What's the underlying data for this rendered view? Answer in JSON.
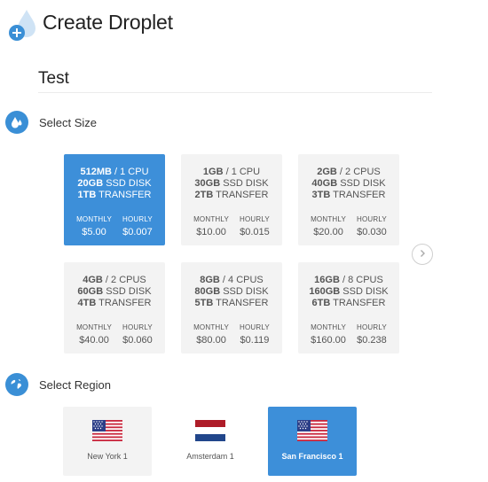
{
  "header": {
    "title": "Create Droplet",
    "logo_icon": "droplet-plus-icon"
  },
  "hostname": {
    "value": "Test"
  },
  "size_section": {
    "title": "Select Size",
    "icon": "droplets-icon",
    "options": [
      {
        "mem": "512MB",
        "cpu": "1 CPU",
        "disk": "20GB",
        "disk_unit": "SSD DISK",
        "transfer": "1TB",
        "transfer_unit": "TRANSFER",
        "monthly_label": "MONTHLY",
        "hourly_label": "HOURLY",
        "monthly": "$5.00",
        "hourly": "$0.007",
        "selected": true
      },
      {
        "mem": "1GB",
        "cpu": "1 CPU",
        "disk": "30GB",
        "disk_unit": "SSD DISK",
        "transfer": "2TB",
        "transfer_unit": "TRANSFER",
        "monthly_label": "MONTHLY",
        "hourly_label": "HOURLY",
        "monthly": "$10.00",
        "hourly": "$0.015",
        "selected": false
      },
      {
        "mem": "2GB",
        "cpu": "2 CPUS",
        "disk": "40GB",
        "disk_unit": "SSD DISK",
        "transfer": "3TB",
        "transfer_unit": "TRANSFER",
        "monthly_label": "MONTHLY",
        "hourly_label": "HOURLY",
        "monthly": "$20.00",
        "hourly": "$0.030",
        "selected": false
      },
      {
        "mem": "4GB",
        "cpu": "2 CPUS",
        "disk": "60GB",
        "disk_unit": "SSD DISK",
        "transfer": "4TB",
        "transfer_unit": "TRANSFER",
        "monthly_label": "MONTHLY",
        "hourly_label": "HOURLY",
        "monthly": "$40.00",
        "hourly": "$0.060",
        "selected": false
      },
      {
        "mem": "8GB",
        "cpu": "4 CPUS",
        "disk": "80GB",
        "disk_unit": "SSD DISK",
        "transfer": "5TB",
        "transfer_unit": "TRANSFER",
        "monthly_label": "MONTHLY",
        "hourly_label": "HOURLY",
        "monthly": "$80.00",
        "hourly": "$0.119",
        "selected": false
      },
      {
        "mem": "16GB",
        "cpu": "8 CPUS",
        "disk": "160GB",
        "disk_unit": "SSD DISK",
        "transfer": "6TB",
        "transfer_unit": "TRANSFER",
        "monthly_label": "MONTHLY",
        "hourly_label": "HOURLY",
        "monthly": "$160.00",
        "hourly": "$0.238",
        "selected": false
      }
    ],
    "next_icon": "chevron-right-icon"
  },
  "region_section": {
    "title": "Select Region",
    "icon": "globe-icon",
    "regions": [
      {
        "name": "New York 1",
        "flag": "us-flag-icon",
        "selected": false
      },
      {
        "name": "Amsterdam 1",
        "flag": "netherlands-flag-icon",
        "selected": false
      },
      {
        "name": "San Francisco 1",
        "flag": "us-flag-icon",
        "selected": true
      }
    ]
  },
  "colors": {
    "accent": "#3d8fd9",
    "card_bg": "#f3f3f3",
    "text": "#333333"
  }
}
